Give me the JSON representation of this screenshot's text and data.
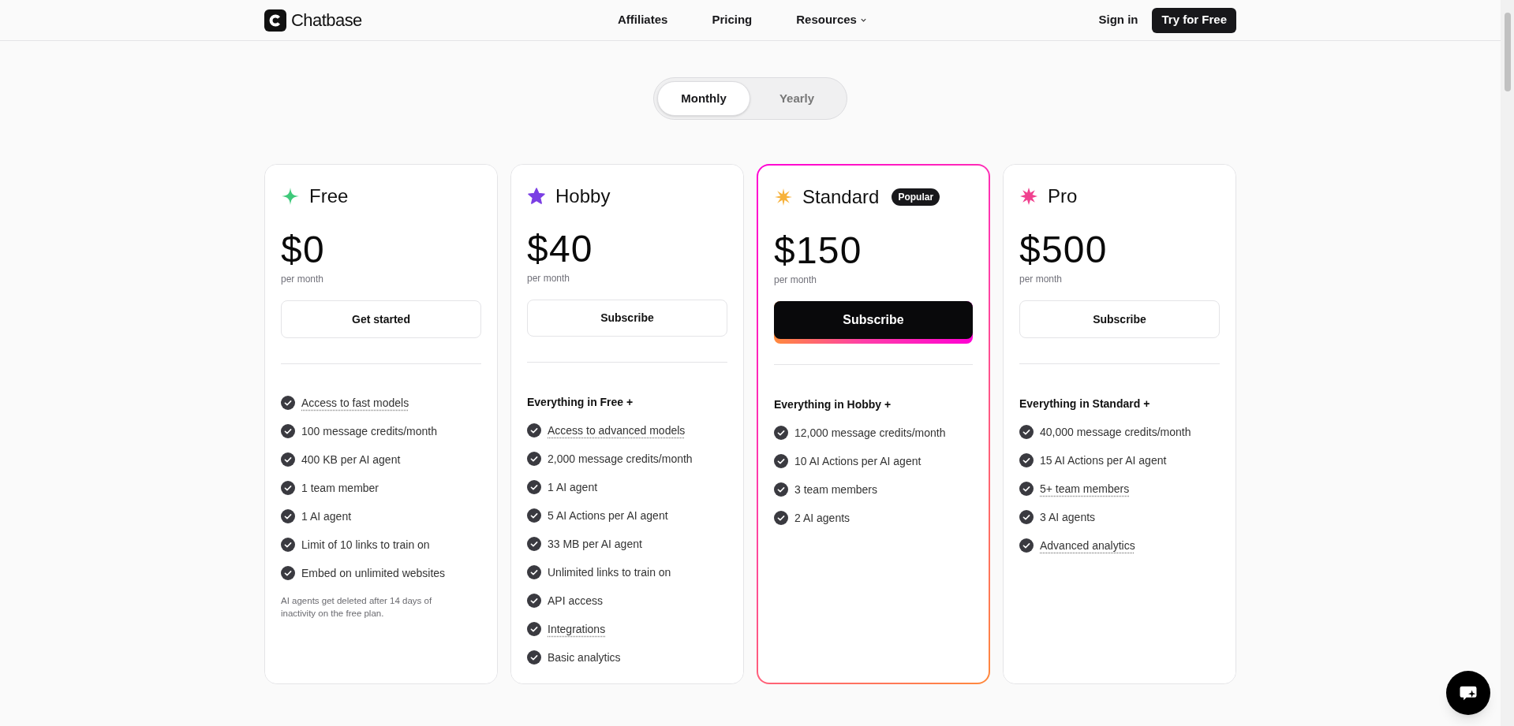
{
  "header": {
    "logo": "Chatbase",
    "nav": [
      {
        "label": "Affiliates",
        "dropdown": false
      },
      {
        "label": "Pricing",
        "dropdown": false
      },
      {
        "label": "Resources",
        "dropdown": true
      }
    ],
    "sign_in": "Sign in",
    "cta": "Try for Free"
  },
  "billing_toggle": [
    {
      "label": "Monthly",
      "selected": true
    },
    {
      "label": "Yearly",
      "selected": false
    }
  ],
  "plans": [
    {
      "name": "Free",
      "color": "#3ec97a",
      "featured": false,
      "price": "$0",
      "period": "per month",
      "button": "Get started",
      "features": [
        {
          "text": "Access to fast models",
          "underlined": true
        },
        {
          "text": "100 message credits/month",
          "underlined": false
        },
        {
          "text": "400 KB per AI agent",
          "underlined": false
        },
        {
          "text": "1 team member",
          "underlined": false
        },
        {
          "text": "1 AI agent",
          "underlined": false
        },
        {
          "text": "Limit of 10 links to train on",
          "underlined": false
        },
        {
          "text": "Embed on unlimited websites",
          "underlined": false
        }
      ],
      "note": "AI agents get deleted after 14 days of inactivity on the free plan."
    },
    {
      "name": "Hobby",
      "color": "#7b3fe4",
      "featured": false,
      "price": "$40",
      "period": "per month",
      "button": "Subscribe",
      "heading": "Everything in Free +",
      "features": [
        {
          "text": "Access to advanced models",
          "underlined": true
        },
        {
          "text": "2,000 message credits/month",
          "underlined": false
        },
        {
          "text": "1 AI agent",
          "underlined": false
        },
        {
          "text": "5 AI Actions per AI agent",
          "underlined": false
        },
        {
          "text": "33 MB per AI agent",
          "underlined": false
        },
        {
          "text": "Unlimited links to train on",
          "underlined": false
        },
        {
          "text": "API access",
          "underlined": false
        },
        {
          "text": "Integrations",
          "underlined": true
        },
        {
          "text": "Basic analytics",
          "underlined": false
        }
      ]
    },
    {
      "name": "Standard",
      "color": "#f7b23b",
      "featured": true,
      "badge": "Popular",
      "price": "$150",
      "period": "per month",
      "button": "Subscribe",
      "heading": "Everything in Hobby +",
      "features": [
        {
          "text": "12,000 message credits/month",
          "underlined": false
        },
        {
          "text": "10 AI Actions per AI agent",
          "underlined": false
        },
        {
          "text": "3 team members",
          "underlined": false
        },
        {
          "text": "2 AI agents",
          "underlined": false
        }
      ]
    },
    {
      "name": "Pro",
      "color": "#f0418f",
      "featured": false,
      "price": "$500",
      "period": "per month",
      "button": "Subscribe",
      "heading": "Everything in Standard +",
      "features": [
        {
          "text": "40,000 message credits/month",
          "underlined": false
        },
        {
          "text": "15 AI Actions per AI agent",
          "underlined": false
        },
        {
          "text": "5+ team members",
          "underlined": true
        },
        {
          "text": "3 AI agents",
          "underlined": false
        },
        {
          "text": "Advanced analytics",
          "underlined": true
        }
      ]
    }
  ]
}
